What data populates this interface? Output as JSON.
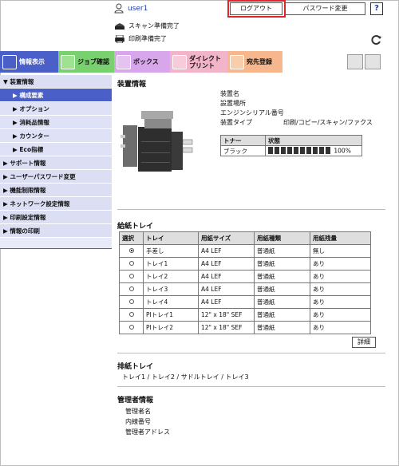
{
  "header": {
    "user": "user1",
    "logout": "ログアウト",
    "password_change": "パスワード変更",
    "help": "?",
    "status_scan": "スキャン準備完了",
    "status_print": "印刷準備完了"
  },
  "tabs": [
    {
      "label": "情報表示"
    },
    {
      "label": "ジョブ確認"
    },
    {
      "label": "ボックス"
    },
    {
      "label": "ダイレクトプリント"
    },
    {
      "label": "宛先登録"
    }
  ],
  "sidebar": {
    "items": [
      {
        "label": "▼ 装置情報"
      },
      {
        "label": "▶ 構成要素"
      },
      {
        "label": "▶ オプション"
      },
      {
        "label": "▶ 消耗品情報"
      },
      {
        "label": "▶ カウンター"
      },
      {
        "label": "▶ Eco指標"
      },
      {
        "label": "▶ サポート情報"
      },
      {
        "label": "▶ ユーザーパスワード変更"
      },
      {
        "label": "▶ 機能制限情報"
      },
      {
        "label": "▶ ネットワーク設定情報"
      },
      {
        "label": "▶ 印刷設定情報"
      },
      {
        "label": "▶ 情報の印刷"
      }
    ]
  },
  "device": {
    "title": "装置情報",
    "fields": [
      "装置名",
      "設置場所",
      "エンジンシリアル番号",
      "装置タイプ"
    ],
    "device_type_value": "印刷/コピー/スキャン/ファクス"
  },
  "toner": {
    "headers": [
      "トナー",
      "状態"
    ],
    "row": {
      "name": "ブラック",
      "percent": "100%",
      "fill": 1.0
    }
  },
  "paper": {
    "title": "給紙トレイ",
    "headers": [
      "選択",
      "トレイ",
      "用紙サイズ",
      "用紙種類",
      "用紙残量"
    ],
    "rows": [
      {
        "tray": "手差し",
        "size": "A4 LEF",
        "type": "普通紙",
        "remaining": "無し",
        "selected": true
      },
      {
        "tray": "トレイ1",
        "size": "A4 LEF",
        "type": "普通紙",
        "remaining": "あり",
        "selected": false
      },
      {
        "tray": "トレイ2",
        "size": "A4 LEF",
        "type": "普通紙",
        "remaining": "あり",
        "selected": false
      },
      {
        "tray": "トレイ3",
        "size": "A4 LEF",
        "type": "普通紙",
        "remaining": "あり",
        "selected": false
      },
      {
        "tray": "トレイ4",
        "size": "A4 LEF",
        "type": "普通紙",
        "remaining": "あり",
        "selected": false
      },
      {
        "tray": "PIトレイ1",
        "size": "12\" x 18\" SEF",
        "type": "普通紙",
        "remaining": "あり",
        "selected": false
      },
      {
        "tray": "PIトレイ2",
        "size": "12\" x 18\" SEF",
        "type": "普通紙",
        "remaining": "あり",
        "selected": false
      }
    ],
    "detail_button": "詳細"
  },
  "exit_tray": {
    "title": "排紙トレイ",
    "value": "トレイ1 / トレイ2 / サドルトレイ / トレイ3"
  },
  "admin": {
    "title": "管理者情報",
    "fields": [
      "管理者名",
      "内線番号",
      "管理者アドレス"
    ]
  }
}
